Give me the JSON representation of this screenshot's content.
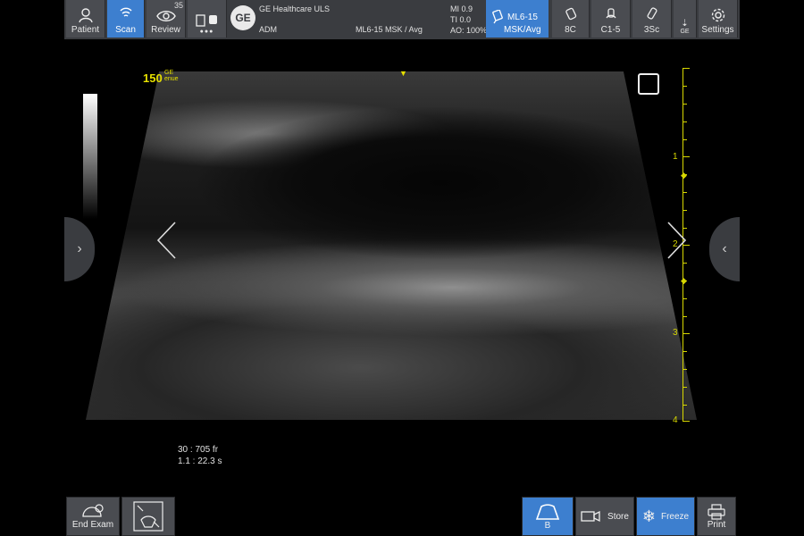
{
  "topbar": {
    "patient_label": "Patient",
    "scan_label": "Scan",
    "review_label": "Review",
    "review_count": "35",
    "more_label": "●●●",
    "ge_logo_text": "GE",
    "facility": "GE Healthcare ULS",
    "operator": "ADM",
    "probe_preset": "ML6-15  MSK / Avg",
    "mi": "MI 0.9",
    "ti": "TI 0.0",
    "ao": "AO: 100%",
    "active_probe_name": "ML6-15",
    "active_probe_preset": "MSK/Avg",
    "probe_8c": "8C",
    "probe_c15": "C1-5",
    "probe_3sc": "3Sc",
    "ge_mini": "GE",
    "settings_label": "Settings"
  },
  "image": {
    "frequency": "150",
    "freq_sub_top": "GE",
    "freq_sub_bot": "enue",
    "orientation_marker": "▼",
    "focus_marker": "◆",
    "depth_labels": [
      "1",
      "2",
      "3",
      "4"
    ],
    "cine_frame": "30 : 705 fr",
    "cine_time": "1.1 : 22.3 s"
  },
  "nav": {
    "prev_arrow": "‹",
    "next_arrow": "›",
    "right_tab_arrow": "‹",
    "left_tab_arrow": "›"
  },
  "bottombar": {
    "end_exam_label": "End Exam",
    "b_label": "B",
    "store_label": "Store",
    "freeze_label": "Freeze",
    "print_label": "Print"
  },
  "colors": {
    "active_blue": "#3d7fcf",
    "yellow": "#e6e000"
  }
}
